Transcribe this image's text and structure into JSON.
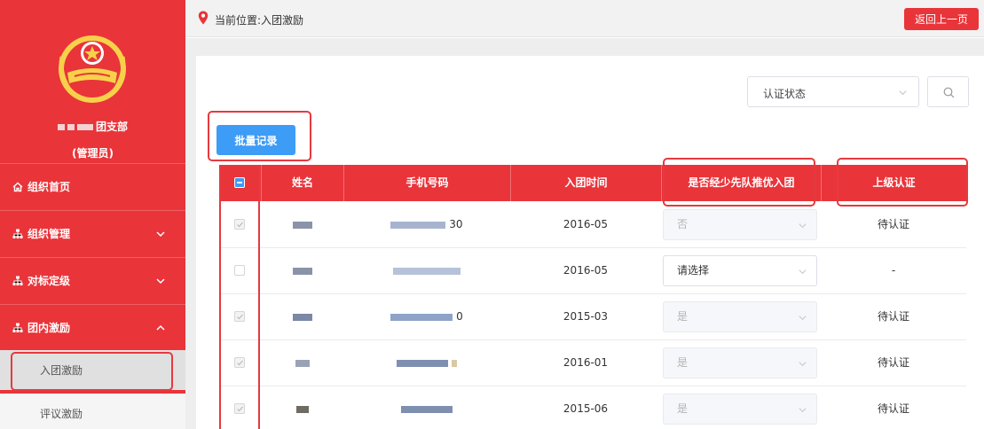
{
  "sidebar": {
    "org_name_suffix": "团支部",
    "role": "(管理员)",
    "nav": [
      {
        "label": "组织首页",
        "icon": "home-icon"
      },
      {
        "label": "组织管理",
        "icon": "org-tree-icon",
        "expanded": false
      },
      {
        "label": "对标定级",
        "icon": "org-tree-icon",
        "expanded": false
      },
      {
        "label": "团内激励",
        "icon": "org-tree-icon",
        "expanded": true
      }
    ],
    "sub_nav": [
      {
        "label": "入团激励",
        "active": true
      },
      {
        "label": "评议激励",
        "active": false
      }
    ]
  },
  "topbar": {
    "location": "当前位置:入团激励",
    "back_label": "返回上一页"
  },
  "filter": {
    "status_select": "认证状态"
  },
  "toolbar": {
    "batch_label": "批量记录"
  },
  "table": {
    "headers": [
      "姓名",
      "手机号码",
      "入团时间",
      "是否经少先队推优入团",
      "上级认证"
    ],
    "rows": [
      {
        "join_time": "2016-05",
        "recommended": "否",
        "recommended_enabled": false,
        "certification": "待认证",
        "checked": true,
        "phone_tail": "30"
      },
      {
        "join_time": "2016-05",
        "recommended": "请选择",
        "recommended_enabled": true,
        "certification": "-",
        "checked": false,
        "phone_tail": ""
      },
      {
        "join_time": "2015-03",
        "recommended": "是",
        "recommended_enabled": false,
        "certification": "待认证",
        "checked": true,
        "phone_tail": "0"
      },
      {
        "join_time": "2016-01",
        "recommended": "是",
        "recommended_enabled": false,
        "certification": "待认证",
        "checked": true,
        "phone_tail": ""
      },
      {
        "join_time": "2015-06",
        "recommended": "是",
        "recommended_enabled": false,
        "certification": "待认证",
        "checked": true,
        "phone_tail": ""
      }
    ]
  },
  "colors": {
    "brand_red": "#e9343a",
    "primary_blue": "#3d9cf5"
  }
}
